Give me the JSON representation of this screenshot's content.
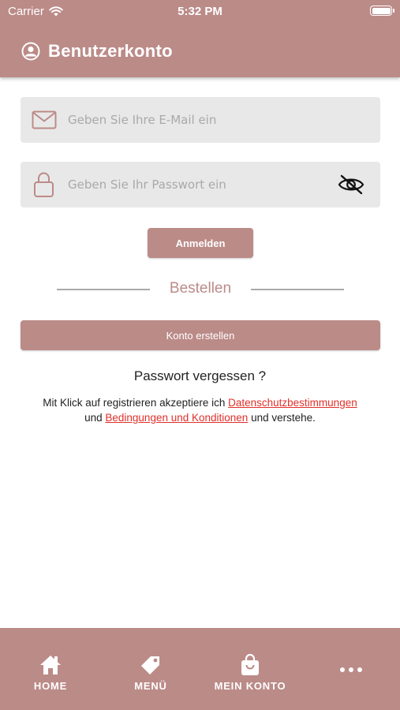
{
  "status_bar": {
    "carrier": "Carrier",
    "time": "5:32 PM"
  },
  "header": {
    "title": "Benutzerkonto",
    "icon": "user-circle-icon"
  },
  "form": {
    "email_placeholder": "Geben Sie Ihre E-Mail ein",
    "email_value": "",
    "password_placeholder": "Geben Sie Ihr Passwort ein",
    "password_value": "",
    "login_label": "Anmelden"
  },
  "divider": {
    "label": "Bestellen"
  },
  "create_account_label": "Konto erstellen",
  "forgot_password": "Passwort vergessen ?",
  "terms": {
    "prefix": "Mit Klick auf registrieren akzeptiere ich ",
    "privacy_link": "Datenschutzbestimmungen",
    "middle": "und ",
    "conditions_link": "Bedingungen und Konditionen",
    "suffix": " und verstehe."
  },
  "tabbar": {
    "items": [
      {
        "label": "HOME",
        "icon": "home-icon"
      },
      {
        "label": "MENÜ",
        "icon": "tag-icon"
      },
      {
        "label": "MEIN KONTO",
        "icon": "shopping-bag-icon"
      },
      {
        "label": "",
        "icon": "more-icon"
      }
    ]
  },
  "colors": {
    "accent": "#bb8b88",
    "field_bg": "#e8e8e8",
    "link": "#e0302a"
  }
}
